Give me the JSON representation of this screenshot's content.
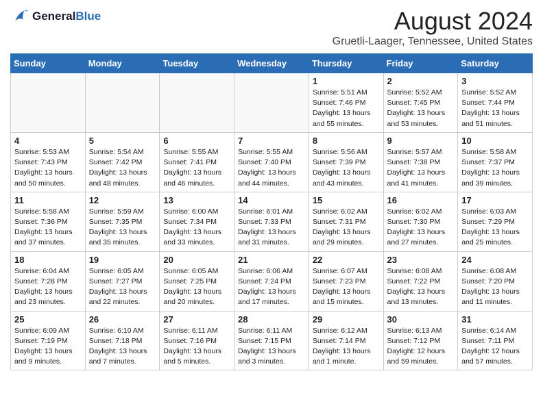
{
  "logo": {
    "line1": "General",
    "line2": "Blue"
  },
  "title": "August 2024",
  "location": "Gruetli-Laager, Tennessee, United States",
  "weekdays": [
    "Sunday",
    "Monday",
    "Tuesday",
    "Wednesday",
    "Thursday",
    "Friday",
    "Saturday"
  ],
  "weeks": [
    [
      {
        "day": "",
        "info": ""
      },
      {
        "day": "",
        "info": ""
      },
      {
        "day": "",
        "info": ""
      },
      {
        "day": "",
        "info": ""
      },
      {
        "day": "1",
        "info": "Sunrise: 5:51 AM\nSunset: 7:46 PM\nDaylight: 13 hours\nand 55 minutes."
      },
      {
        "day": "2",
        "info": "Sunrise: 5:52 AM\nSunset: 7:45 PM\nDaylight: 13 hours\nand 53 minutes."
      },
      {
        "day": "3",
        "info": "Sunrise: 5:52 AM\nSunset: 7:44 PM\nDaylight: 13 hours\nand 51 minutes."
      }
    ],
    [
      {
        "day": "4",
        "info": "Sunrise: 5:53 AM\nSunset: 7:43 PM\nDaylight: 13 hours\nand 50 minutes."
      },
      {
        "day": "5",
        "info": "Sunrise: 5:54 AM\nSunset: 7:42 PM\nDaylight: 13 hours\nand 48 minutes."
      },
      {
        "day": "6",
        "info": "Sunrise: 5:55 AM\nSunset: 7:41 PM\nDaylight: 13 hours\nand 46 minutes."
      },
      {
        "day": "7",
        "info": "Sunrise: 5:55 AM\nSunset: 7:40 PM\nDaylight: 13 hours\nand 44 minutes."
      },
      {
        "day": "8",
        "info": "Sunrise: 5:56 AM\nSunset: 7:39 PM\nDaylight: 13 hours\nand 43 minutes."
      },
      {
        "day": "9",
        "info": "Sunrise: 5:57 AM\nSunset: 7:38 PM\nDaylight: 13 hours\nand 41 minutes."
      },
      {
        "day": "10",
        "info": "Sunrise: 5:58 AM\nSunset: 7:37 PM\nDaylight: 13 hours\nand 39 minutes."
      }
    ],
    [
      {
        "day": "11",
        "info": "Sunrise: 5:58 AM\nSunset: 7:36 PM\nDaylight: 13 hours\nand 37 minutes."
      },
      {
        "day": "12",
        "info": "Sunrise: 5:59 AM\nSunset: 7:35 PM\nDaylight: 13 hours\nand 35 minutes."
      },
      {
        "day": "13",
        "info": "Sunrise: 6:00 AM\nSunset: 7:34 PM\nDaylight: 13 hours\nand 33 minutes."
      },
      {
        "day": "14",
        "info": "Sunrise: 6:01 AM\nSunset: 7:33 PM\nDaylight: 13 hours\nand 31 minutes."
      },
      {
        "day": "15",
        "info": "Sunrise: 6:02 AM\nSunset: 7:31 PM\nDaylight: 13 hours\nand 29 minutes."
      },
      {
        "day": "16",
        "info": "Sunrise: 6:02 AM\nSunset: 7:30 PM\nDaylight: 13 hours\nand 27 minutes."
      },
      {
        "day": "17",
        "info": "Sunrise: 6:03 AM\nSunset: 7:29 PM\nDaylight: 13 hours\nand 25 minutes."
      }
    ],
    [
      {
        "day": "18",
        "info": "Sunrise: 6:04 AM\nSunset: 7:28 PM\nDaylight: 13 hours\nand 23 minutes."
      },
      {
        "day": "19",
        "info": "Sunrise: 6:05 AM\nSunset: 7:27 PM\nDaylight: 13 hours\nand 22 minutes."
      },
      {
        "day": "20",
        "info": "Sunrise: 6:05 AM\nSunset: 7:25 PM\nDaylight: 13 hours\nand 20 minutes."
      },
      {
        "day": "21",
        "info": "Sunrise: 6:06 AM\nSunset: 7:24 PM\nDaylight: 13 hours\nand 17 minutes."
      },
      {
        "day": "22",
        "info": "Sunrise: 6:07 AM\nSunset: 7:23 PM\nDaylight: 13 hours\nand 15 minutes."
      },
      {
        "day": "23",
        "info": "Sunrise: 6:08 AM\nSunset: 7:22 PM\nDaylight: 13 hours\nand 13 minutes."
      },
      {
        "day": "24",
        "info": "Sunrise: 6:08 AM\nSunset: 7:20 PM\nDaylight: 13 hours\nand 11 minutes."
      }
    ],
    [
      {
        "day": "25",
        "info": "Sunrise: 6:09 AM\nSunset: 7:19 PM\nDaylight: 13 hours\nand 9 minutes."
      },
      {
        "day": "26",
        "info": "Sunrise: 6:10 AM\nSunset: 7:18 PM\nDaylight: 13 hours\nand 7 minutes."
      },
      {
        "day": "27",
        "info": "Sunrise: 6:11 AM\nSunset: 7:16 PM\nDaylight: 13 hours\nand 5 minutes."
      },
      {
        "day": "28",
        "info": "Sunrise: 6:11 AM\nSunset: 7:15 PM\nDaylight: 13 hours\nand 3 minutes."
      },
      {
        "day": "29",
        "info": "Sunrise: 6:12 AM\nSunset: 7:14 PM\nDaylight: 13 hours\nand 1 minute."
      },
      {
        "day": "30",
        "info": "Sunrise: 6:13 AM\nSunset: 7:12 PM\nDaylight: 12 hours\nand 59 minutes."
      },
      {
        "day": "31",
        "info": "Sunrise: 6:14 AM\nSunset: 7:11 PM\nDaylight: 12 hours\nand 57 minutes."
      }
    ]
  ]
}
